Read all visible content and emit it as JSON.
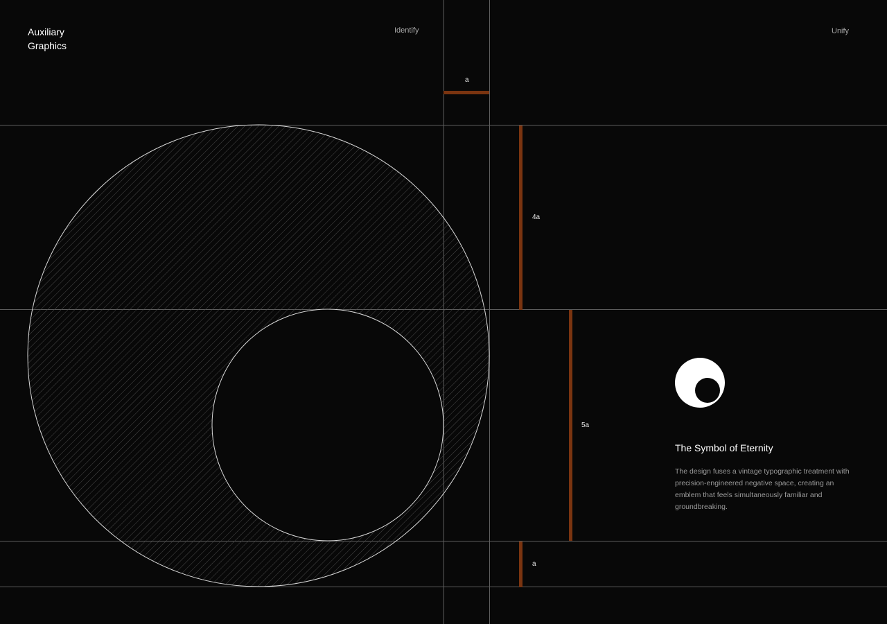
{
  "header": {
    "title_line1": "Auxiliary",
    "title_line2": "Graphics",
    "nav_identify": "Identify",
    "nav_unify": "Unify"
  },
  "measurements": {
    "top_unit": "a",
    "upper_vertical": "4a",
    "lower_vertical": "5a",
    "bottom_unit": "a"
  },
  "symbol": {
    "heading": "The Symbol of Eternity",
    "description": "The design fuses a vintage typographic treatment with precision-engineered negative space, creating an emblem that feels simultaneously familiar and groundbreaking."
  },
  "colors": {
    "background": "#080808",
    "guide_line": "#6a6a6a",
    "accent": "#7a3410",
    "foreground": "#ffffff"
  }
}
